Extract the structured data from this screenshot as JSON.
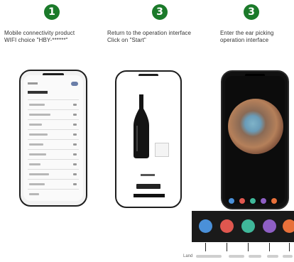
{
  "steps": [
    {
      "number": "1",
      "line1": "Mobile connectivity product",
      "line2": "WIFI choice  \"HBY-******\""
    },
    {
      "number": "3",
      "line1": "Return to the operation interface",
      "line2": "Click on  \"Start\""
    },
    {
      "number": "3",
      "line1": "Enter the ear picking",
      "line2": "operation interface"
    }
  ],
  "footer": {
    "label": "Land"
  },
  "colors": {
    "badge": "#1b7a2a",
    "swatches": [
      "#4a90d9",
      "#e0574f",
      "#3fb89a",
      "#8e5fc4",
      "#e8703a"
    ]
  },
  "icons": [
    "wifi-signal-icon",
    "bottle-icon",
    "ear-camera-view-icon",
    "color-dot-icon"
  ]
}
